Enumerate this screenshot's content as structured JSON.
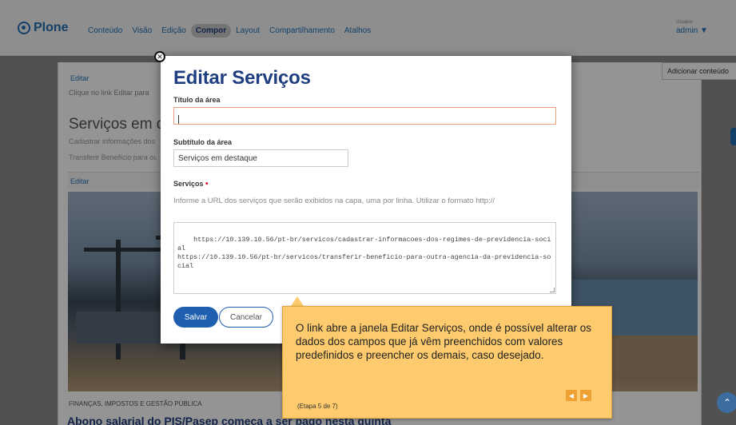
{
  "topbar": {
    "logo": "Plone",
    "nav": [
      "Conteúdo",
      "Visão",
      "Edição",
      "Compor",
      "Layout",
      "Compartilhamento",
      "Atalhos"
    ],
    "active_nav": "Compor",
    "user_label": "Usuário",
    "user_name": "admin ▼"
  },
  "background": {
    "add_content": "Adicionar conteúdo",
    "edit_link_1": "Editar",
    "hint": "Clique no link Editar para",
    "section_title": "Serviços em destaque",
    "link_1": "Cadastrar informações dos regimes",
    "link_2": "Transferir Benefício para outra",
    "edit_link_2": "Editar",
    "category": "Finanças, Impostos e Gestão Pública",
    "headline": "Abono salarial do PIS/Pasep começa a ser pago nesta quinta"
  },
  "modal": {
    "title": "Editar Serviços",
    "field_title_label": "Título da área",
    "field_title_value": "",
    "field_subtitle_label": "Subtítulo da área",
    "field_subtitle_value": "Serviços em destaque",
    "field_services_label": "Serviços",
    "required_mark": "•",
    "help_text": "Informe a URL dos serviços que serão exibidos na capa, uma por linha. Utilizar o formato http://",
    "services_value": "https://10.139.10.56/pt-br/servicos/cadastrar-informacoes-dos-regimes-de-previdencia-social\nhttps://10.139.10.56/pt-br/servicos/transferir-beneficio-para-outra-agencia-da-previdencia-social",
    "save_label": "Salvar",
    "cancel_label": "Cancelar",
    "close_glyph": "✕"
  },
  "tooltip": {
    "text": "O link abre a janela Editar Serviços, onde é possível alterar os dados dos campos que já vêm preenchidos com valores predefinidos e preencher os demais, caso desejado.",
    "step": "(Etapa 5 de 7)",
    "prev_glyph": "◀",
    "next_glyph": "▶"
  },
  "scroll_top_glyph": "⌃",
  "colors": {
    "brand": "#1f6fb5",
    "title_blue": "#1f3f80",
    "tooltip_bg": "#fdcb6e",
    "save_button": "#1f5fb0"
  }
}
